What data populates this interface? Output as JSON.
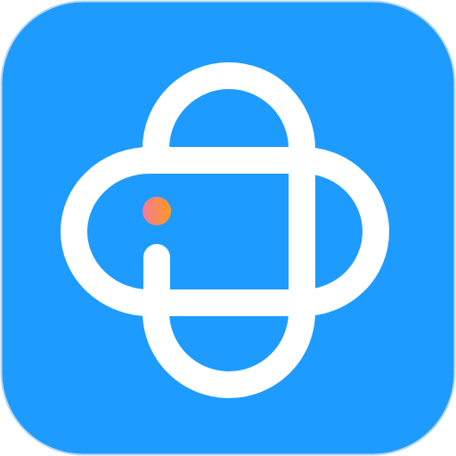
{
  "app_icon": {
    "name": "app-logo-icon",
    "colors": {
      "background": "#1E9BFF",
      "border": "#B9D7EE",
      "mark": "#FFFFFF",
      "dot_start": "#F27A9A",
      "dot_end": "#FF9A1F"
    }
  }
}
